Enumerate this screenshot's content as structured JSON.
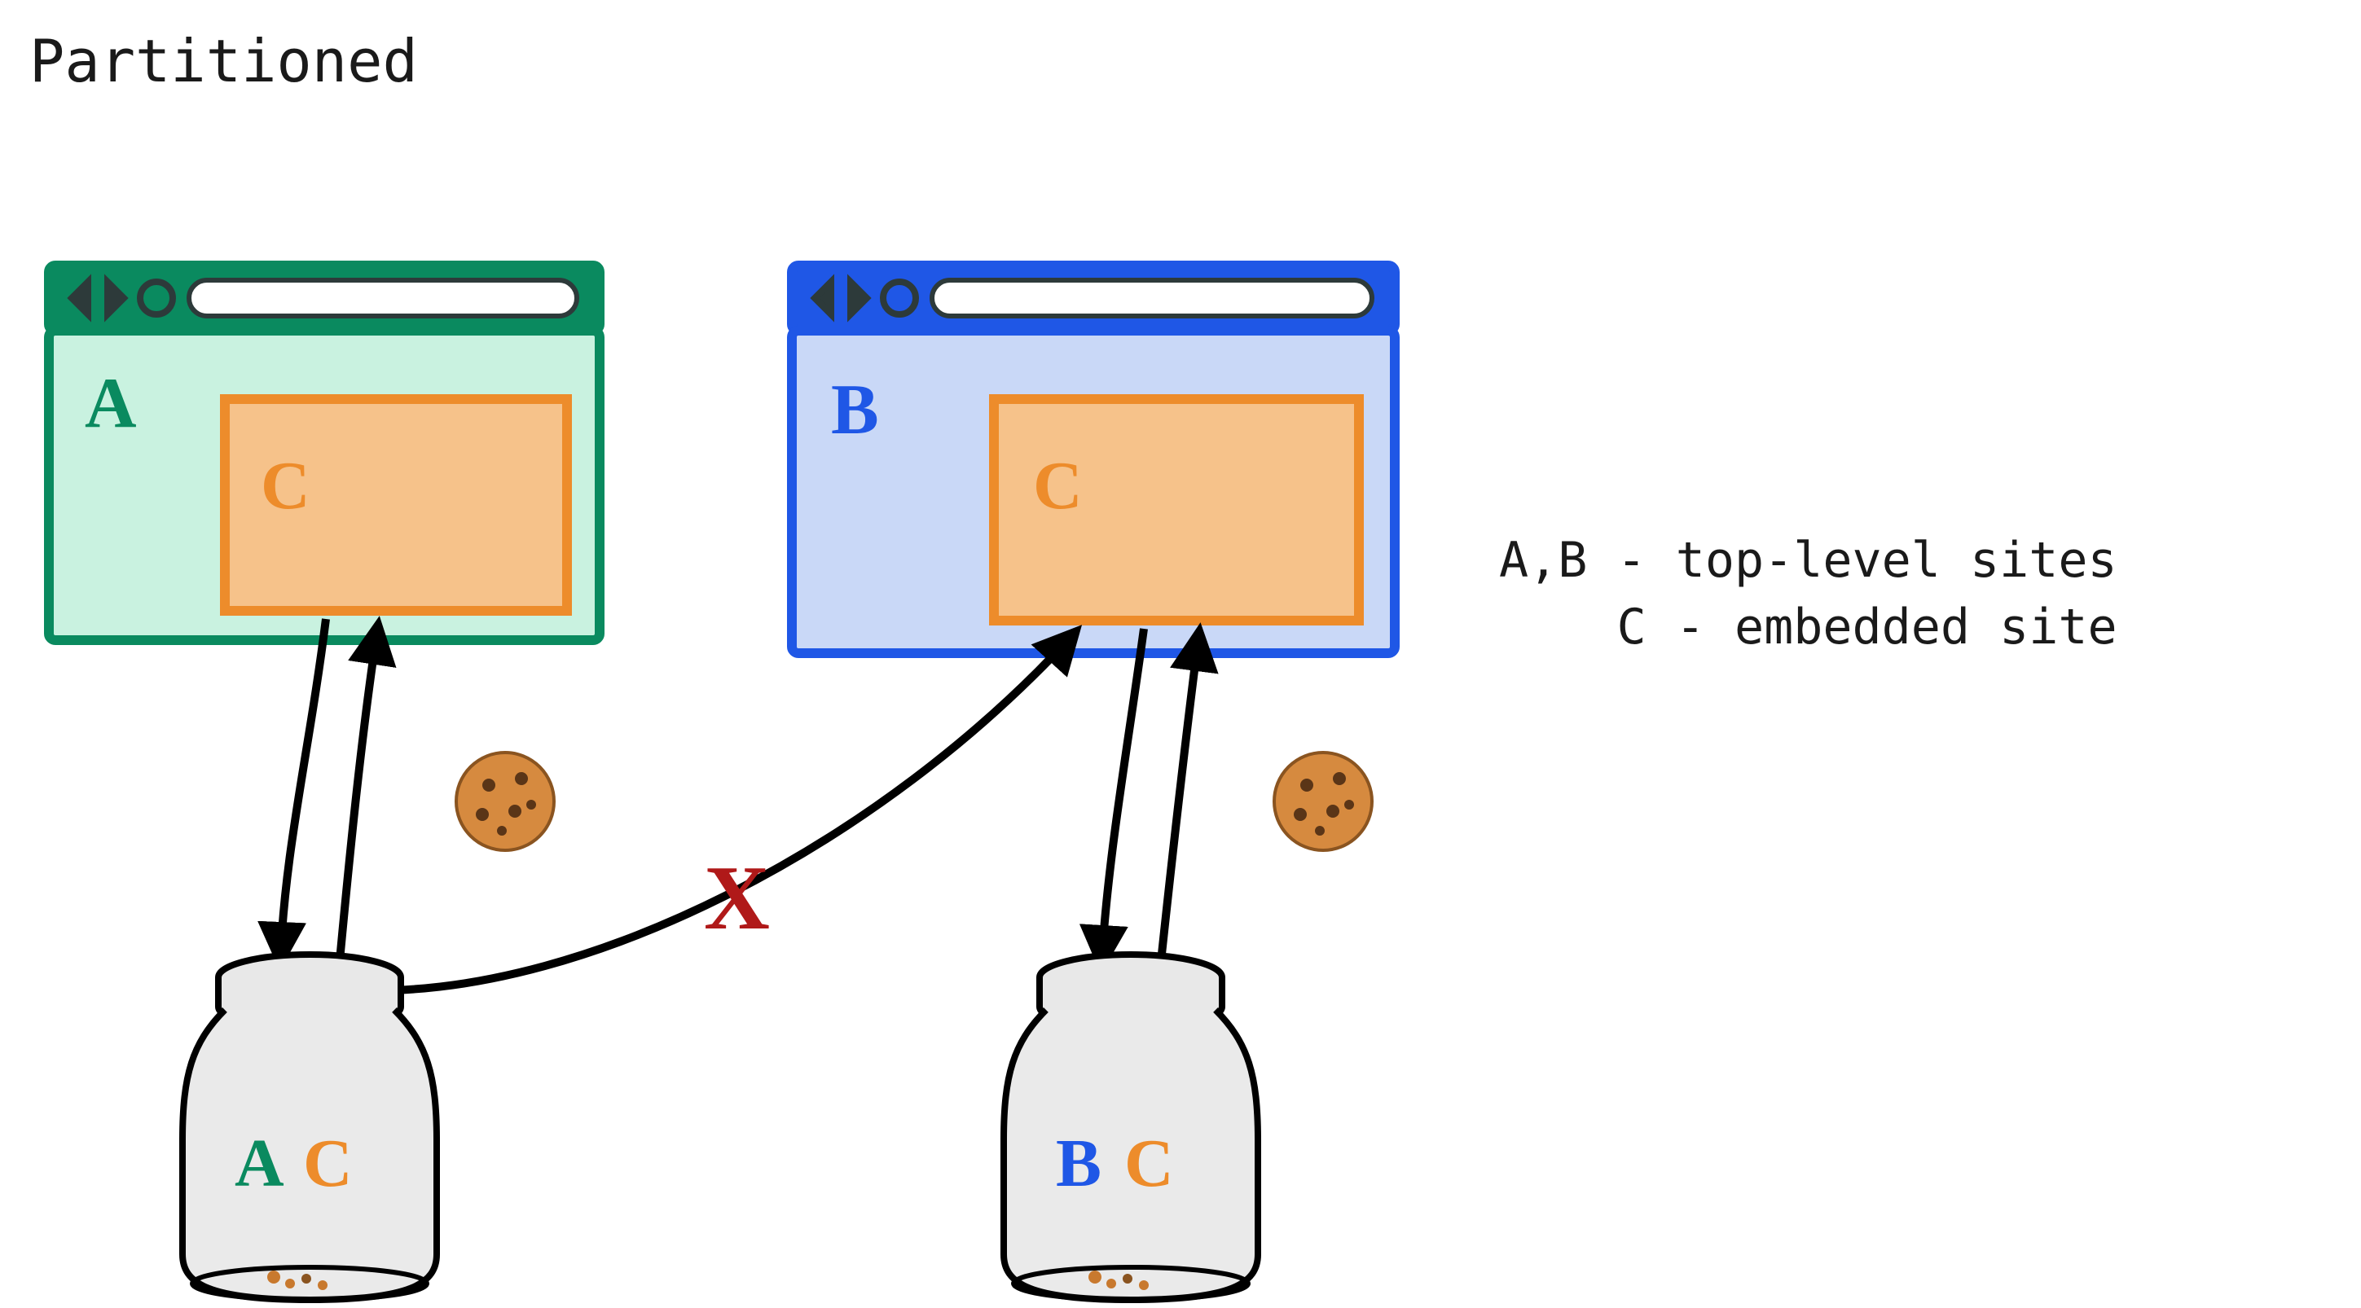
{
  "title": "Partitioned",
  "legend": {
    "line1": "A,B - top-level sites",
    "line2": "    C - embedded site"
  },
  "browsers": [
    {
      "id": "A",
      "label": "A",
      "color": "#0a8a5f",
      "fill": "#c9f2e0",
      "embed": {
        "label": "C",
        "color": "#ed8c2b",
        "fill": "#f6c28a"
      }
    },
    {
      "id": "B",
      "label": "B",
      "color": "#1f57e6",
      "fill": "#c9d8f7",
      "embed": {
        "label": "C",
        "color": "#ed8c2b",
        "fill": "#f6c28a"
      }
    }
  ],
  "jars": [
    {
      "id": "AC",
      "label_primary": "A",
      "label_secondary": "C",
      "primary_color": "#0a8a5f",
      "secondary_color": "#ed8c2b"
    },
    {
      "id": "BC",
      "label_primary": "B",
      "label_secondary": "C",
      "primary_color": "#1f57e6",
      "secondary_color": "#ed8c2b"
    }
  ],
  "cross_marker": "X",
  "cross_color": "#b01919",
  "arrow_color": "#000000",
  "cookie_color": "#c8792e",
  "chip_color": "#5a3517"
}
